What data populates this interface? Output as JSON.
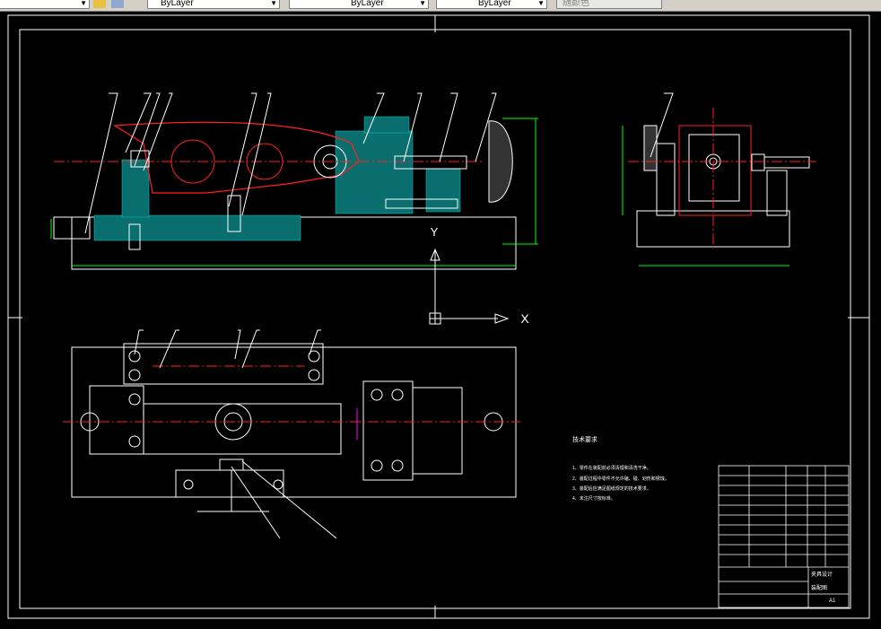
{
  "toolbar": {
    "color_control": "ByLayer",
    "linetype_control": "ByLayer",
    "lineweight_control": "ByLayer",
    "plotstyle_control": "随颜色"
  },
  "drawing": {
    "axis_x_label": "X",
    "axis_y_label": "Y",
    "tech_requirements_title": "技术要求",
    "tech_requirements": [
      "1、零件在装配前必须清理和清洗干净。",
      "2、装配过程中零件不允许磕、碰、划伤和锈蚀。",
      "3、装配后应满足图纸规定的技术要求。",
      "4、未注尺寸按标准。"
    ],
    "title_block": {
      "name": "夹具设计",
      "drawing_no": "装配图",
      "sheet": "A1"
    }
  },
  "colors": {
    "background": "#000000",
    "lines": "#ffffff",
    "hidden": "#ff0000",
    "dimension": "#00ff00",
    "hatch": "#00ffff",
    "magenta": "#ff00ff"
  }
}
